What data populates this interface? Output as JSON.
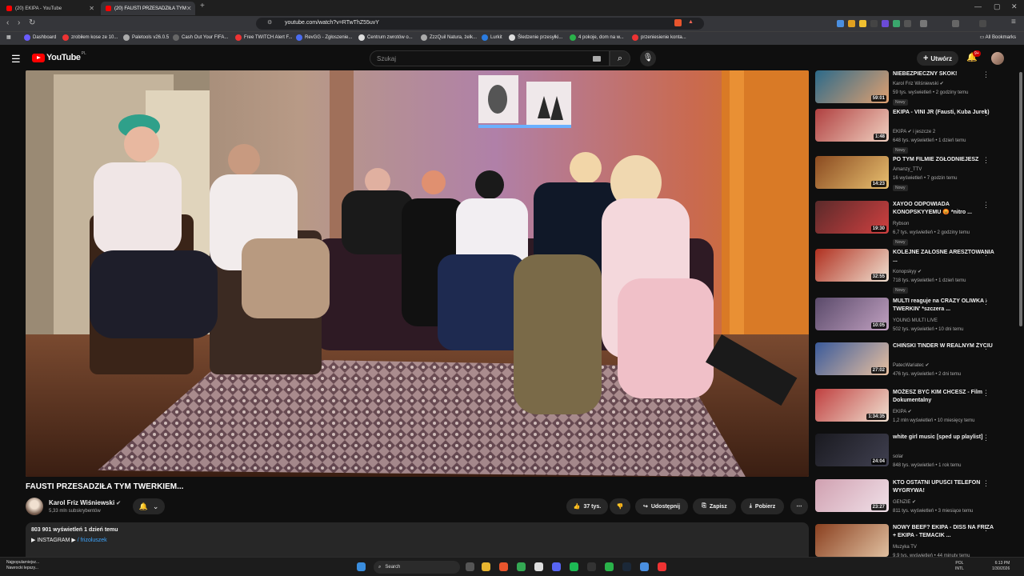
{
  "browser": {
    "tabs": [
      {
        "label": "(20) EKIPA - YouTube"
      },
      {
        "label": "(20) FAUSTI PRZESADZIŁA TYM"
      }
    ],
    "url": "youtube.com/watch?v=RTwThZ55uvY",
    "bookmarks": [
      "Dashboard",
      "zrobiłem kose ze 10...",
      "Paletools v26.0.5",
      "Cash Out Your FIFA...",
      "Free TWITCH Alert F...",
      "RevGG - Zgłoszenie...",
      "Centrum zwrotów o...",
      "ZzzQuil Natura, żelk...",
      "Lurkit",
      "Śledzenie przesyłki...",
      "4 pokoje, dom na w...",
      "przeniesienie konta..."
    ],
    "all_bookmarks": "All Bookmarks"
  },
  "youtube": {
    "logo_text": "YouTube",
    "logo_region": "PL",
    "search_placeholder": "Szukaj",
    "create_label": "Utwórz",
    "notif_count": "9+"
  },
  "video": {
    "title": "FAUSTI PRZESADZIŁA TYM TWERKIEM...",
    "channel": "Karol Friz Wiśniewski",
    "subscribers": "5,33 mln subskrybentów",
    "likes": "37 tys.",
    "share_label": "Udostępnij",
    "save_label": "Zapisz",
    "download_label": "Pobierz",
    "views_line": "803 901 wyświetleń  1 dzień temu",
    "instagram_prefix": "▶ INSTAGRAM ▶",
    "instagram_handle": "/ frizoluszek"
  },
  "recommendations": [
    {
      "title": "NIEBEZPIECZNY SKOK!",
      "channel": "Karol Friz Wiśniewski ✔",
      "meta": "59 tys. wyświetleń • 2 godziny temu",
      "badge": "Nowy",
      "duration": "59:01"
    },
    {
      "title": "EKIPA - VINI JR (Fausti, Kuba Jurek)",
      "channel": "EKIPA ✔ i jeszcze 2",
      "meta": "648 tys. wyświetleń • 1 dzień temu",
      "badge": "Nowy",
      "duration": "1:48"
    },
    {
      "title": "PO TYM FILMIE ZGŁODNIEJESZ",
      "channel": "Amanzy_TTV",
      "meta": "16 wyświetleń • 7 godzin temu",
      "badge": "Nowy",
      "duration": "14:23"
    },
    {
      "title": "XAYOO ODPOWIADA KONOPSKYYEMU 😡 *nitro ...",
      "channel": "Rybson",
      "meta": "6,7 tys. wyświetleń • 2 godziny temu",
      "badge": "Nowy",
      "duration": "19:30"
    },
    {
      "title": "KOLEJNE ZAŁOSNE ARESZTOWANIA ...",
      "channel": "Konopskyy ✔",
      "meta": "718 tys. wyświetleń • 1 dzień temu",
      "badge": "Nowy",
      "duration": "32:55"
    },
    {
      "title": "MULTI reaguje na CRAZY OLIWKA - TWERKIN' *szczera ...",
      "channel": "YOUNG MULTI LIVE",
      "meta": "502 tys. wyświetleń • 10 dni temu",
      "badge": "",
      "duration": "10:05"
    },
    {
      "title": "CHIŃSKI TINDER W REALNYM ŻYCIU",
      "channel": "PatecWariatec ✔",
      "meta": "476 tys. wyświetleń • 2 dni temu",
      "badge": "",
      "duration": "27:02"
    },
    {
      "title": "MOŻESZ BYĆ KIM CHCESZ - Film Dokumentalny",
      "channel": "EKIPA ✔",
      "meta": "1,2 mln wyświetleń • 10 miesięcy temu",
      "badge": "",
      "duration": "1:34:35"
    },
    {
      "title": "white girl music [sped up playlist]",
      "channel": "solar",
      "meta": "848 tys. wyświetleń • 1 rok temu",
      "badge": "",
      "duration": "24:04"
    },
    {
      "title": "KTO OSTATNI UPUŚCI TELEFON WYGRYWA!",
      "channel": "GENZIE ✔",
      "meta": "811 tys. wyświetleń • 3 miesiące temu",
      "badge": "",
      "duration": "23:27"
    },
    {
      "title": "NOWY BEEF? EKIPA - DISS NA FRIZA + EKIPA - TEMACIK ...",
      "channel": "Muzyka TV",
      "meta": "9,9 tys. wyświetleń • 44 minuty temu",
      "badge": "",
      "duration": ""
    }
  ],
  "taskbar": {
    "weather_line1": "Najpopularniejsz...",
    "weather_line2": "Nawrocki lepszy...",
    "search_label": "Search",
    "lang1": "POL",
    "lang2": "INTL",
    "time": "6:13 PM",
    "date": "1/30/2026"
  }
}
